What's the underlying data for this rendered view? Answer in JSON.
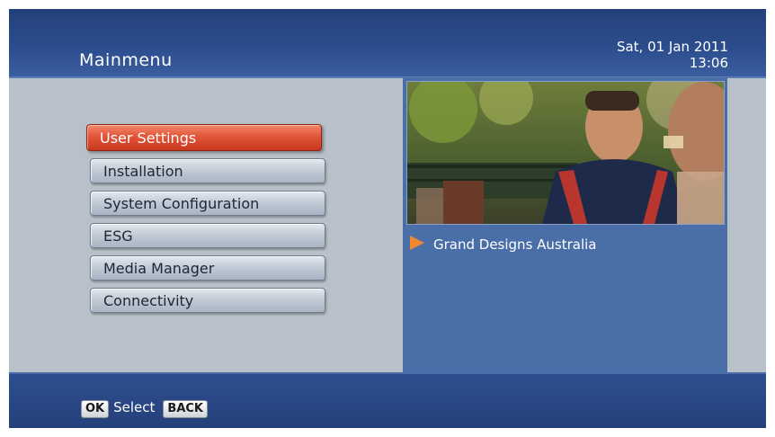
{
  "header": {
    "title": "Mainmenu",
    "date": "Sat, 01 Jan 2011",
    "time": "13:06"
  },
  "menu": {
    "items": [
      {
        "label": "User Settings",
        "selected": true
      },
      {
        "label": "Installation",
        "selected": false
      },
      {
        "label": "System Configuration",
        "selected": false
      },
      {
        "label": "ESG",
        "selected": false
      },
      {
        "label": "Media Manager",
        "selected": false
      },
      {
        "label": "Connectivity",
        "selected": false
      }
    ]
  },
  "preview": {
    "channel_name": "Grand Designs Australia",
    "icon": "play-arrow-icon"
  },
  "footer": {
    "ok_key": "OK",
    "ok_label": "Select",
    "back_key": "BACK"
  },
  "colors": {
    "header_blue": "#24407a",
    "selected_red": "#e2563a",
    "panel_blue": "#4a6ea7",
    "arrow_orange": "#f08a32"
  }
}
